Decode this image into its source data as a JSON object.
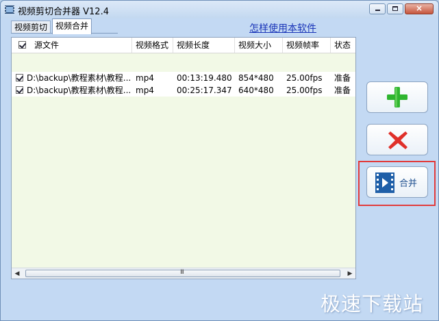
{
  "window": {
    "title": "视频剪切合并器 V12.4",
    "controls": {
      "minimize_glyph": "",
      "maximize_glyph": "",
      "close_glyph": "×"
    }
  },
  "tabs": [
    {
      "label": "视频剪切",
      "active": false
    },
    {
      "label": "视频合并",
      "active": true
    }
  ],
  "help_link": "怎样使用本软件",
  "table": {
    "columns": [
      "源文件",
      "视频格式",
      "视频长度",
      "视频大小",
      "视频帧率",
      "状态"
    ],
    "rows": [
      {
        "checked": true,
        "cells": [
          "D:\\backup\\教程素材\\教程...",
          "mp4",
          "00:13:19.480",
          "854*480",
          "25.00fps",
          "准备"
        ]
      },
      {
        "checked": true,
        "cells": [
          "D:\\backup\\教程素材\\教程...",
          "mp4",
          "00:25:17.347",
          "640*480",
          "25.00fps",
          "准备"
        ]
      }
    ],
    "scrollbar": {
      "left_arrow": "◀",
      "right_arrow": "▶",
      "grip": "III"
    }
  },
  "buttons": {
    "add": {
      "icon": "plus-icon"
    },
    "remove": {
      "icon": "red-x-icon"
    },
    "merge": {
      "icon": "film-icon",
      "label": "合并"
    }
  },
  "colors": {
    "add_icon": "#2fb52f",
    "remove_icon": "#e0302a",
    "merge_icon": "#1f5fa8",
    "highlight": "#e23a3a",
    "link": "#1a35b8"
  },
  "watermark": "极速下载站"
}
